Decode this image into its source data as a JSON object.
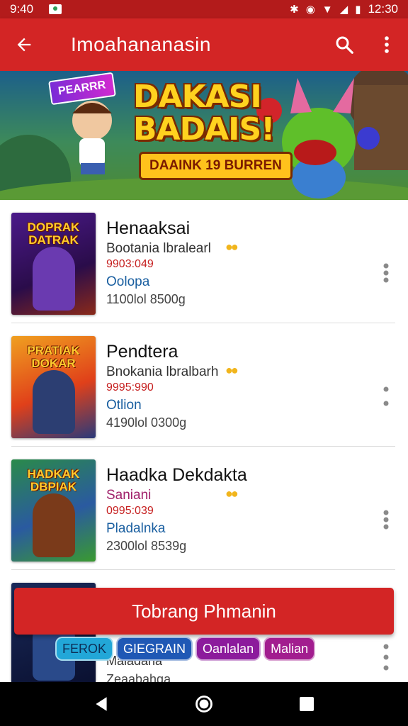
{
  "status_bar": {
    "time_left": "9:40",
    "time_right": "12:30"
  },
  "app_bar": {
    "title": "Imoahananasin"
  },
  "banner": {
    "tag": "PEARRR",
    "headline_line1": "DAKASI",
    "headline_line2": "BADAIS!",
    "subtitle": "DAAINK 19 BURREN"
  },
  "items": [
    {
      "thumb_title": "DOPRAK DATRAK",
      "name": "Henaaksai",
      "subtitle": "Bootania lbralearl",
      "code": "9903:049",
      "category": "Oolopa",
      "meta": "1100lol 8500g"
    },
    {
      "thumb_title": "PRATIAK DOKAR",
      "name": "Pendtera",
      "subtitle": "Bnokania lbralbarh",
      "code": "9995:990",
      "category": "Otlion",
      "meta": "4190lol 0300g"
    },
    {
      "thumb_title": "HADKAK DBPIAK",
      "name": "Haadka Dekdakta",
      "subtitle": "Saniani",
      "code": "0995:039",
      "category": "Pladalnka",
      "meta": "2300lol 8539g"
    },
    {
      "name": "Maladaha",
      "meta": "Zeaabahga"
    }
  ],
  "cta": {
    "label": "Tobrang Phmanin"
  },
  "chips": [
    "FEROK",
    "GIEGRAIN",
    "Oanlalan",
    "Malian"
  ],
  "colors": {
    "primary": "#d32525",
    "status_bar": "#b31b1b",
    "code_red": "#c62020",
    "category_blue": "#1a5fa0"
  },
  "icons": [
    "back-arrow-icon",
    "search-icon",
    "overflow-menu-icon",
    "nav-back-icon",
    "nav-home-icon",
    "nav-recents-icon"
  ]
}
